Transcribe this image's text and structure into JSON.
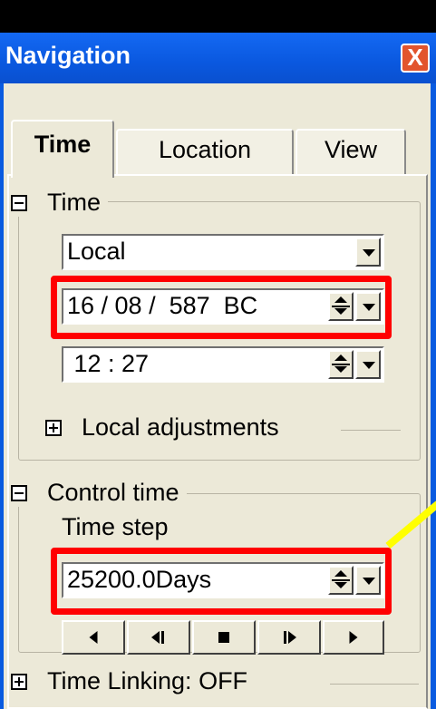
{
  "window": {
    "title": "Navigation",
    "close_label": "X"
  },
  "tabs": [
    {
      "label": "Time",
      "active": true
    },
    {
      "label": "Location",
      "active": false
    },
    {
      "label": "View",
      "active": false
    }
  ],
  "time_group": {
    "header": "Time",
    "timezone_value": "Local",
    "date_value": "16 / 08 /  587  BC",
    "time_value": " 12 : 27"
  },
  "local_adjustments": {
    "label": "Local adjustments"
  },
  "control_time": {
    "header": "Control time",
    "time_step_label": "Time step",
    "time_step_value": "25200.0Days",
    "buttons": [
      "play-backward",
      "step-backward",
      "stop",
      "step-forward",
      "play-forward"
    ]
  },
  "time_linking": {
    "label": "Time Linking: OFF"
  },
  "colors": {
    "highlight": "#ff0000",
    "arrow": "#ffff00",
    "titlebar": "#0a58df",
    "face": "#ece9d8"
  }
}
